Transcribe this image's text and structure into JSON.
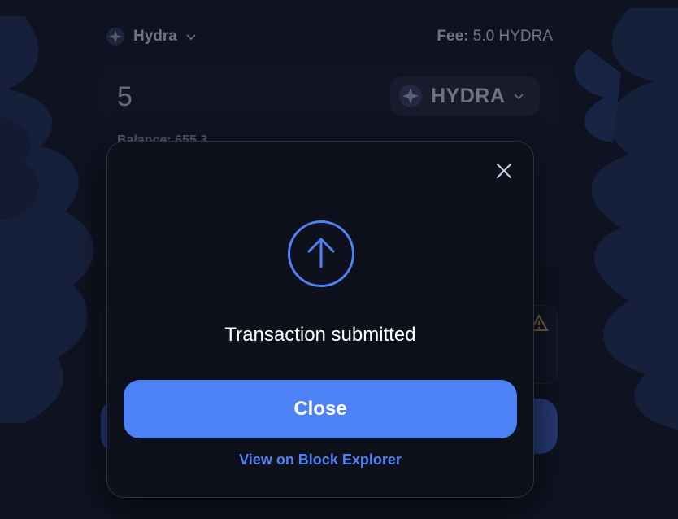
{
  "network": {
    "name": "Hydra",
    "icon": "hydra-logo-icon"
  },
  "fee": {
    "label": "Fee:",
    "value": "5.0 HYDRA"
  },
  "amount": {
    "value": "5"
  },
  "token": {
    "symbol": "HYDRA",
    "icon": "hydra-logo-icon"
  },
  "balance": {
    "text": "Balance: 655.3"
  },
  "modal": {
    "title": "Transaction submitted",
    "primary_button": "Close",
    "link": "View on Block Explorer",
    "status_icon": "arrow-up-circle-icon"
  },
  "colors": {
    "background": "#0f1220",
    "modal": "#0e111c",
    "accent": "#4d82f7",
    "text": "#ffffff"
  }
}
